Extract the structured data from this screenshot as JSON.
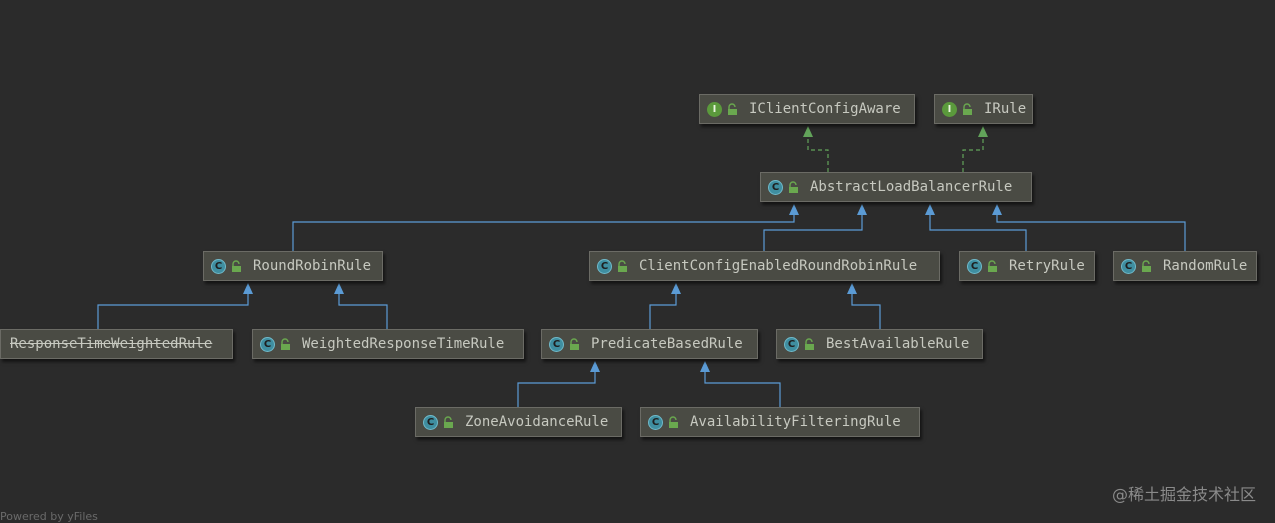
{
  "nodes": [
    {
      "id": "IClientConfigAware",
      "kind": "interface",
      "badge": "I",
      "label": "IClientConfigAware",
      "deprecated": false
    },
    {
      "id": "IRule",
      "kind": "interface",
      "badge": "I",
      "label": "IRule",
      "deprecated": false
    },
    {
      "id": "AbstractLoadBalancerRule",
      "kind": "class",
      "badge": "C",
      "label": "AbstractLoadBalancerRule",
      "deprecated": false
    },
    {
      "id": "RoundRobinRule",
      "kind": "class",
      "badge": "C",
      "label": "RoundRobinRule",
      "deprecated": false
    },
    {
      "id": "ClientConfigEnabledRoundRobinRule",
      "kind": "class",
      "badge": "C",
      "label": "ClientConfigEnabledRoundRobinRule",
      "deprecated": false
    },
    {
      "id": "RetryRule",
      "kind": "class",
      "badge": "C",
      "label": "RetryRule",
      "deprecated": false
    },
    {
      "id": "RandomRule",
      "kind": "class",
      "badge": "C",
      "label": "RandomRule",
      "deprecated": false
    },
    {
      "id": "ResponseTimeWeightedRule",
      "kind": "class",
      "badge": "C",
      "label": "ResponseTimeWeightedRule",
      "deprecated": true
    },
    {
      "id": "WeightedResponseTimeRule",
      "kind": "class",
      "badge": "C",
      "label": "WeightedResponseTimeRule",
      "deprecated": false
    },
    {
      "id": "PredicateBasedRule",
      "kind": "class",
      "badge": "C",
      "label": "PredicateBasedRule",
      "deprecated": false
    },
    {
      "id": "BestAvailableRule",
      "kind": "class",
      "badge": "C",
      "label": "BestAvailableRule",
      "deprecated": false
    },
    {
      "id": "ZoneAvoidanceRule",
      "kind": "class",
      "badge": "C",
      "label": "ZoneAvoidanceRule",
      "deprecated": false
    },
    {
      "id": "AvailabilityFilteringRule",
      "kind": "class",
      "badge": "C",
      "label": "AvailabilityFilteringRule",
      "deprecated": false
    }
  ],
  "edges": [
    {
      "from": "AbstractLoadBalancerRule",
      "to": "IClientConfigAware",
      "type": "implements"
    },
    {
      "from": "AbstractLoadBalancerRule",
      "to": "IRule",
      "type": "implements"
    },
    {
      "from": "RoundRobinRule",
      "to": "AbstractLoadBalancerRule",
      "type": "extends"
    },
    {
      "from": "ClientConfigEnabledRoundRobinRule",
      "to": "AbstractLoadBalancerRule",
      "type": "extends"
    },
    {
      "from": "RetryRule",
      "to": "AbstractLoadBalancerRule",
      "type": "extends"
    },
    {
      "from": "RandomRule",
      "to": "AbstractLoadBalancerRule",
      "type": "extends"
    },
    {
      "from": "ResponseTimeWeightedRule",
      "to": "RoundRobinRule",
      "type": "extends"
    },
    {
      "from": "WeightedResponseTimeRule",
      "to": "RoundRobinRule",
      "type": "extends"
    },
    {
      "from": "PredicateBasedRule",
      "to": "ClientConfigEnabledRoundRobinRule",
      "type": "extends"
    },
    {
      "from": "BestAvailableRule",
      "to": "ClientConfigEnabledRoundRobinRule",
      "type": "extends"
    },
    {
      "from": "ZoneAvoidanceRule",
      "to": "PredicateBasedRule",
      "type": "extends"
    },
    {
      "from": "AvailabilityFilteringRule",
      "to": "PredicateBasedRule",
      "type": "extends"
    }
  ],
  "colors": {
    "background": "#2b2b2b",
    "node_fill": "#4a4b44",
    "extends_edge": "#5b9bd5",
    "implements_edge": "#62a35a",
    "class_badge": "#3f8ea0",
    "interface_badge": "#5b9a3c"
  },
  "icons": {
    "lock": "lock-icon"
  },
  "watermark": "@稀土掘金技术社区",
  "footer": "Powered by yFiles"
}
